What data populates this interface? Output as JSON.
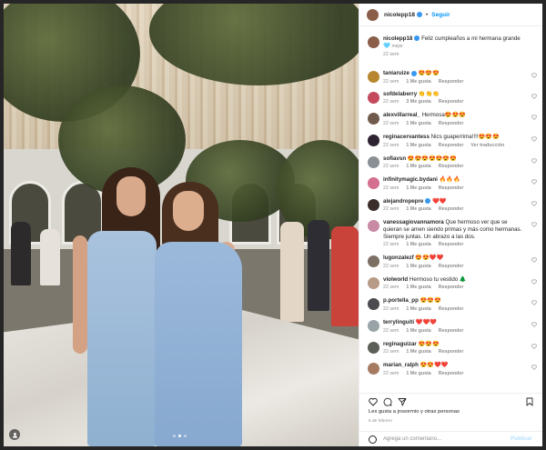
{
  "post": {
    "author": "nicolepp18",
    "follow_label": "Seguir",
    "caption_author": "nicolepp18",
    "caption": "Feliz cumpleaños a mi hermana grande 🩵",
    "caption_tail": "mejor",
    "caption_time": "22 sem",
    "photo": {
      "description_icon": "media-indicator-icon",
      "dots": 3,
      "active_dot": 1
    }
  },
  "comments": [
    {
      "user": "taniaruize",
      "verified": true,
      "text": "😍😍😍",
      "time": "22 sem",
      "likes": "1 Me gusta",
      "reply": "Responder",
      "avatar_color": "#b8862e"
    },
    {
      "user": "sofdelaberry",
      "verified": false,
      "text": "👏👏👏",
      "time": "22 sem",
      "likes": "3 Me gusta",
      "reply": "Responder",
      "avatar_color": "#c44a5b"
    },
    {
      "user": "alexvillarreal_",
      "verified": false,
      "text": "Hermosa😍😍😍",
      "time": "22 sem",
      "likes": "1 Me gusta",
      "reply": "Responder",
      "avatar_color": "#6f5a4b"
    },
    {
      "user": "reginacervantess",
      "verified": false,
      "text": "Nics guaperrima!!!!😍😍😍",
      "time": "22 sem",
      "likes": "1 Me gusta",
      "reply": "Responder",
      "extra": "Ver traducción",
      "avatar_color": "#2e2330"
    },
    {
      "user": "sofiavsn",
      "verified": false,
      "text": "😍😍😍😍😍😍😍",
      "time": "22 sem",
      "likes": "1 Me gusta",
      "reply": "Responder",
      "avatar_color": "#8a8f95"
    },
    {
      "user": "infinitymagic.bydani",
      "verified": false,
      "text": "🔥🔥🔥",
      "time": "22 sem",
      "likes": "1 Me gusta",
      "reply": "Responder",
      "avatar_color": "#d46f8f"
    },
    {
      "user": "alejandropepre",
      "verified": true,
      "text": "❤️❤️",
      "time": "22 sem",
      "likes": "1 Me gusta",
      "reply": "Responder",
      "avatar_color": "#3b2e2a"
    },
    {
      "user": "vanessagiovannamora",
      "verified": false,
      "text": "Que hermoso ver que se quieran se amen siendo primas y más como hermanas. Siempre juntas. Un abrazo a las dos.",
      "time": "22 sem",
      "likes": "1 Me gusta",
      "reply": "Responder",
      "avatar_color": "#c98aa4"
    },
    {
      "user": "lugonzalezf",
      "verified": false,
      "text": "😍😍❤️❤️",
      "time": "22 sem",
      "likes": "1 Me gusta",
      "reply": "Responder",
      "avatar_color": "#7c6f63"
    },
    {
      "user": "violworld",
      "verified": false,
      "text": "Hermoso tu vestido 🌲",
      "time": "22 sem",
      "likes": "1 Me gusta",
      "reply": "Responder",
      "avatar_color": "#b89b86"
    },
    {
      "user": "p.portella_pp",
      "verified": false,
      "text": "😍😍😍",
      "time": "22 sem",
      "likes": "1 Me gusta",
      "reply": "Responder",
      "avatar_color": "#4b4b50"
    },
    {
      "user": "terrylinguiti",
      "verified": false,
      "text": "❤️❤️❤️",
      "time": "22 sem",
      "likes": "1 Me gusta",
      "reply": "Responder",
      "avatar_color": "#9aa4a8"
    },
    {
      "user": "reginaguizar",
      "verified": false,
      "text": "😍😍😍",
      "time": "22 sem",
      "likes": "1 Me gusta",
      "reply": "Responder",
      "avatar_color": "#5c5f57"
    },
    {
      "user": "marian_ralph",
      "verified": false,
      "text": "😍😍❤️❤️",
      "time": "22 sem",
      "likes": "1 Me gusta",
      "reply": "Responder",
      "avatar_color": "#a77b61"
    }
  ],
  "footer": {
    "likes_text": "Les gusta a jrosormio y otras personas",
    "date": "6 de febrero",
    "comment_placeholder": "Agrega un comentario...",
    "publish_label": "Publicar"
  },
  "colors": {
    "link": "#0095f6",
    "muted": "#8e8e8e",
    "text": "#262626",
    "verified": "#3897f0"
  }
}
